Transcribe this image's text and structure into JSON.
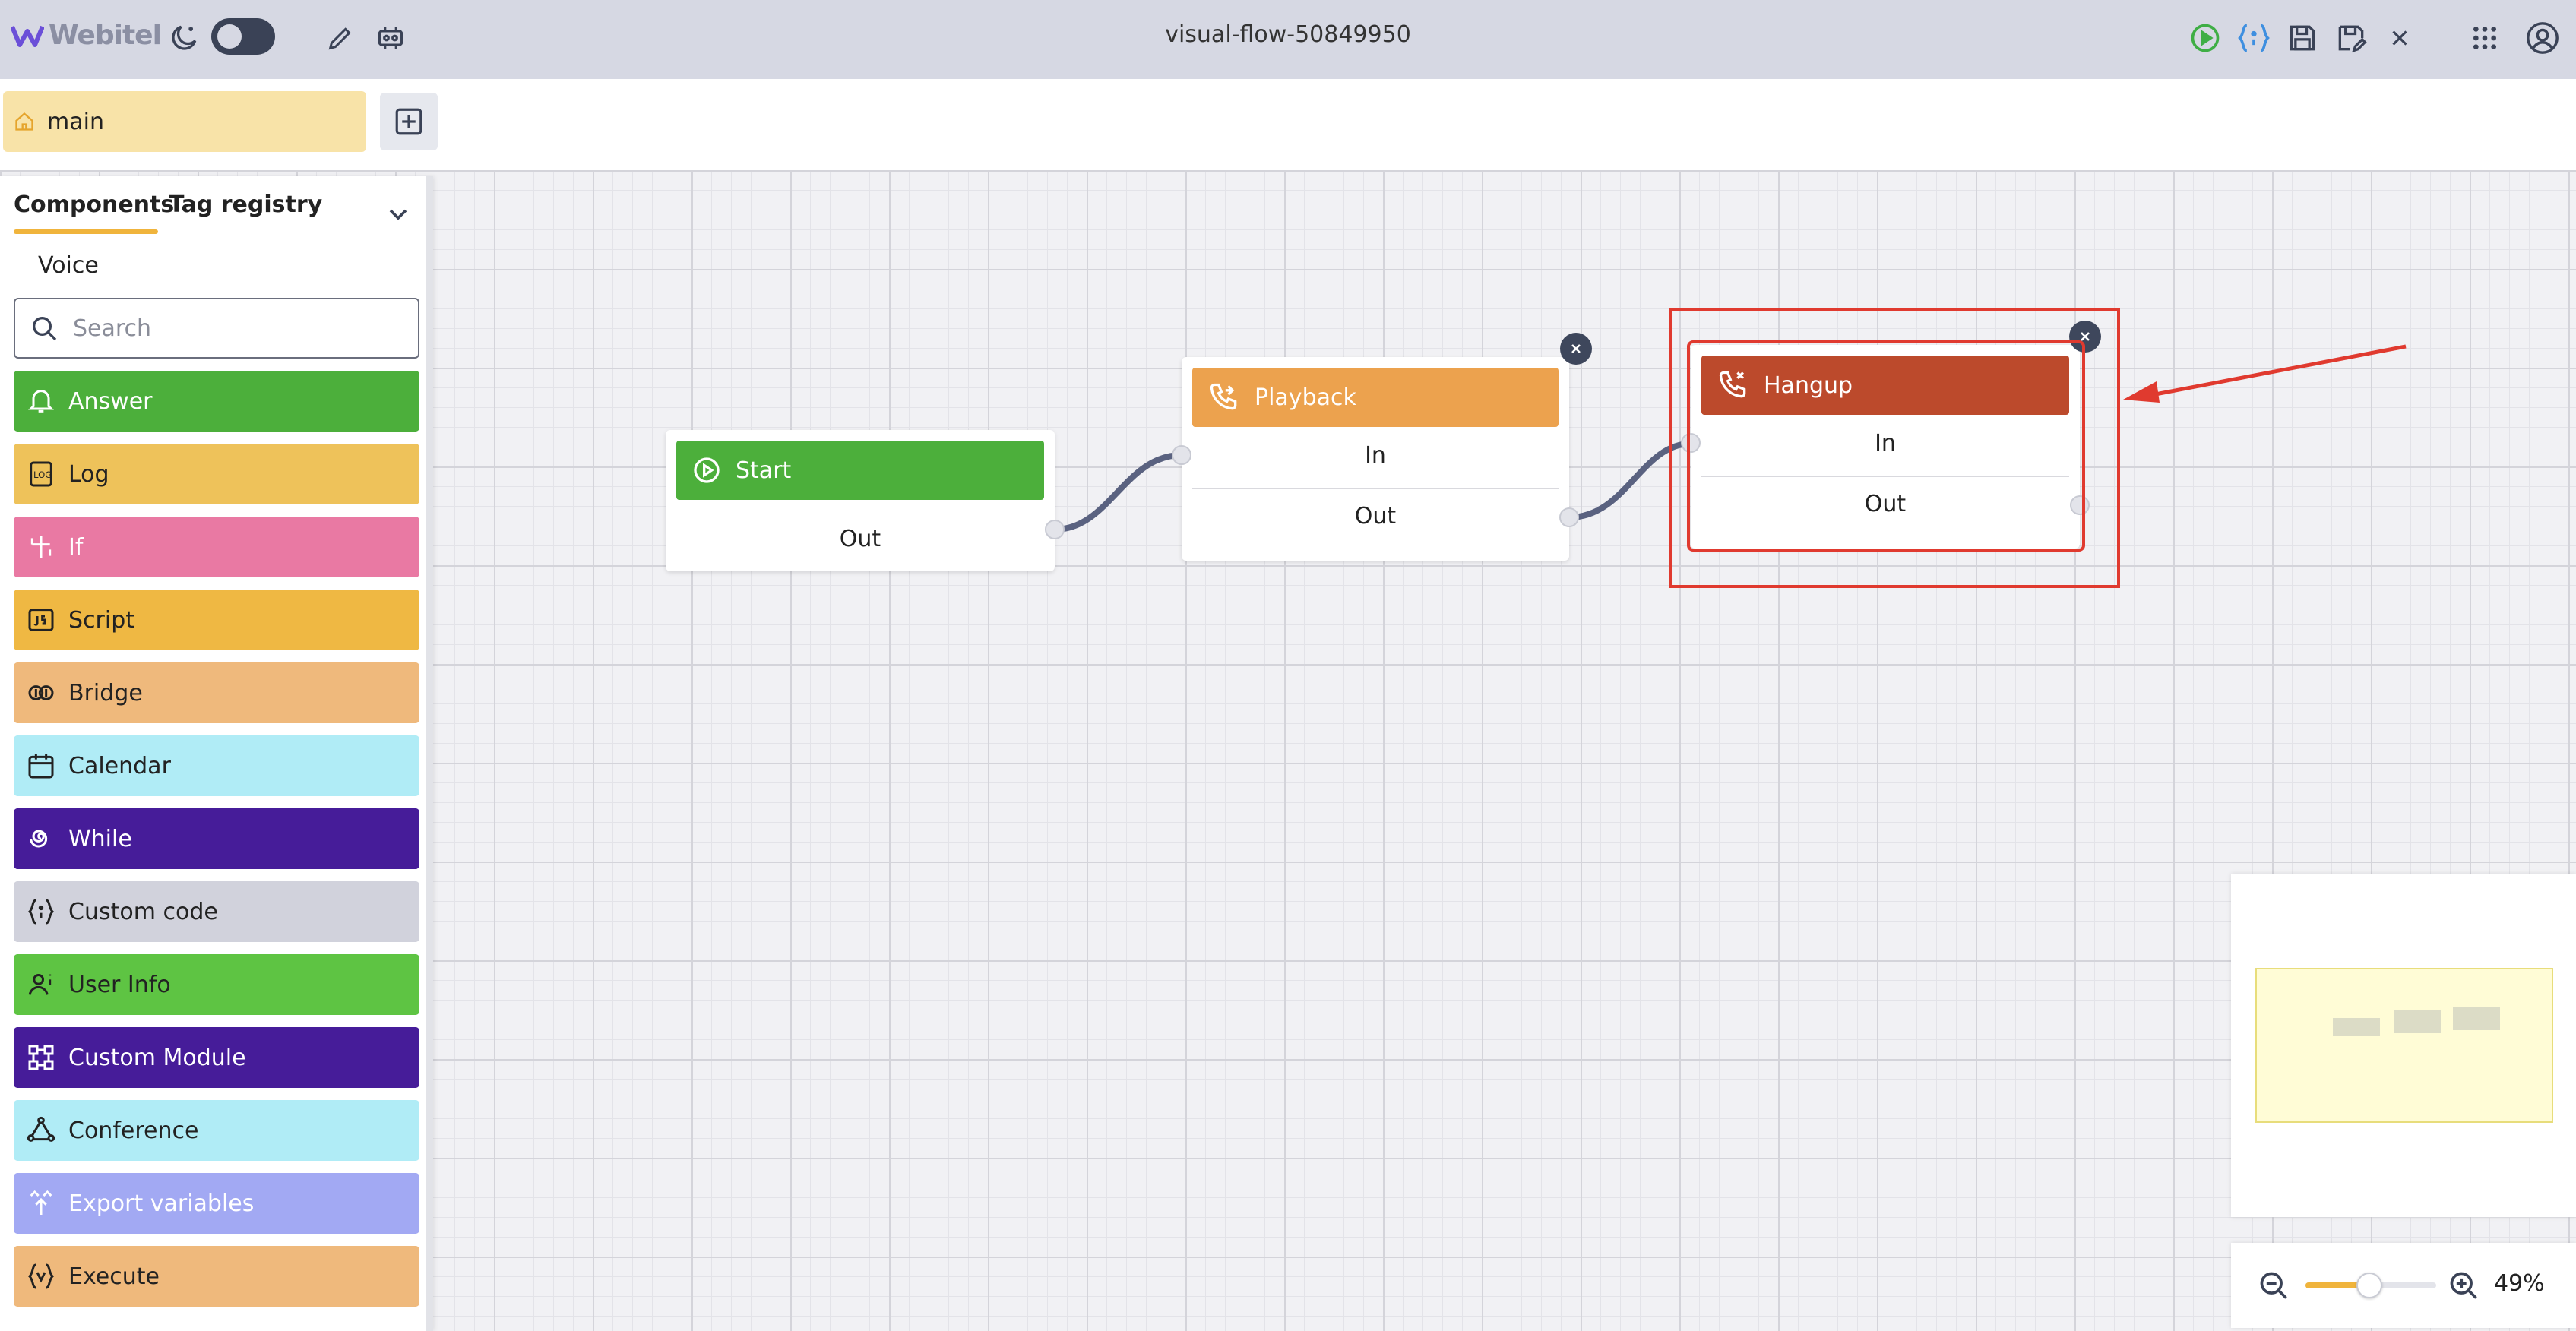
{
  "header": {
    "logo_text": "Webitel",
    "flow_title": "visual-flow-50849950",
    "icons": [
      "moon-icon",
      "theme-toggle",
      "pencil-icon",
      "settings-icon",
      "play-icon",
      "code-icon",
      "save-icon",
      "save-as-icon",
      "close-icon",
      "apps-grid-icon",
      "account-icon"
    ]
  },
  "tabs": {
    "main_label": "main",
    "add_icon": "plus-square-icon"
  },
  "sidebar": {
    "tab_components": "Components",
    "tab_tag_registry": "Tag registry",
    "category": "Voice",
    "search_placeholder": "Search",
    "components": [
      {
        "label": "Answer",
        "icon": "bell-icon",
        "bg": "#4caf3b",
        "fg": "#ffffff"
      },
      {
        "label": "Log",
        "icon": "log-icon",
        "bg": "#eec25a",
        "fg": "#222222"
      },
      {
        "label": "If",
        "icon": "branch-icon",
        "bg": "#e979a3",
        "fg": "#ffffff"
      },
      {
        "label": "Script",
        "icon": "js-icon",
        "bg": "#efb843",
        "fg": "#222222"
      },
      {
        "label": "Bridge",
        "icon": "bridge-icon",
        "bg": "#efb97c",
        "fg": "#222222"
      },
      {
        "label": "Calendar",
        "icon": "calendar-icon",
        "bg": "#b0ecf6",
        "fg": "#222222"
      },
      {
        "label": "While",
        "icon": "spiral-icon",
        "bg": "#461c99",
        "fg": "#ffffff"
      },
      {
        "label": "Custom code",
        "icon": "braces-icon",
        "bg": "#d1d2dc",
        "fg": "#222222"
      },
      {
        "label": "User Info",
        "icon": "user-info-icon",
        "bg": "#5ec443",
        "fg": "#222222"
      },
      {
        "label": "Custom Module",
        "icon": "module-icon",
        "bg": "#461c99",
        "fg": "#ffffff"
      },
      {
        "label": "Conference",
        "icon": "conference-icon",
        "bg": "#b0ecf6",
        "fg": "#222222"
      },
      {
        "label": "Export variables",
        "icon": "export-icon",
        "bg": "#a2a9f3",
        "fg": "#ffffff"
      },
      {
        "label": "Execute",
        "icon": "execute-icon",
        "bg": "#efb97c",
        "fg": "#222222"
      }
    ]
  },
  "nodes": {
    "start": {
      "title": "Start",
      "out": "Out",
      "color": "#4caf3b",
      "icon": "play-circle-icon"
    },
    "playback": {
      "title": "Playback",
      "in": "In",
      "out": "Out",
      "color": "#eca24e",
      "icon": "phone-incoming-icon"
    },
    "hangup": {
      "title": "Hangup",
      "in": "In",
      "out": "Out",
      "color": "#bc4a2c",
      "icon": "phone-hangup-icon"
    }
  },
  "annotation": {
    "color": "#e03a2f"
  },
  "zoom": {
    "value": 0.49,
    "label": "49%"
  }
}
